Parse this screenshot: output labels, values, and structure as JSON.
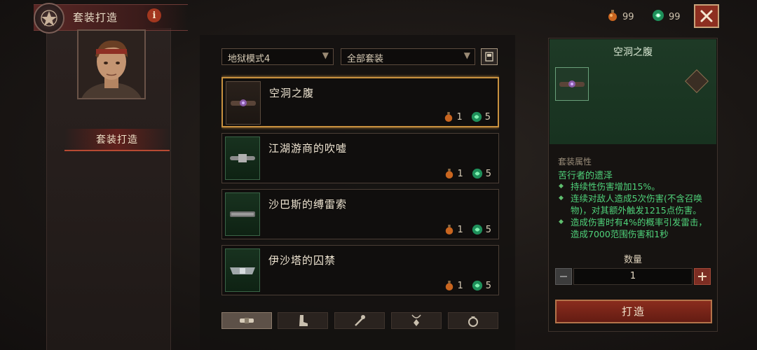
{
  "header": {
    "title": "套装打造",
    "info_icon": "info-icon",
    "emblem_icon": "pentagram-icon"
  },
  "sidebar": {
    "tab_label": "套装打造"
  },
  "currency": [
    {
      "icon": "potion-icon",
      "amount": "99"
    },
    {
      "icon": "green-gem-icon",
      "amount": "99"
    }
  ],
  "close_icon": "close-icon",
  "filters": {
    "difficulty": "地狱模式4",
    "set": "全部套装",
    "codex_icon": "book-icon"
  },
  "items": [
    {
      "name": "空洞之腹",
      "potion": "1",
      "gem": "5",
      "selected": true,
      "icon": "belt-icon"
    },
    {
      "name": "江湖游商的吹嘘",
      "potion": "1",
      "gem": "5",
      "selected": false,
      "icon": "belt-icon"
    },
    {
      "name": "沙巴斯的缚雷索",
      "potion": "1",
      "gem": "5",
      "selected": false,
      "icon": "belt-icon"
    },
    {
      "name": "伊沙塔的囚禁",
      "potion": "1",
      "gem": "5",
      "selected": false,
      "icon": "belt-icon"
    }
  ],
  "bottom_tabs": [
    {
      "icon": "belt-icon",
      "active": true
    },
    {
      "icon": "boots-icon",
      "active": false
    },
    {
      "icon": "wand-icon",
      "active": false
    },
    {
      "icon": "amulet-icon",
      "active": false
    },
    {
      "icon": "ring-icon",
      "active": false
    }
  ],
  "detail": {
    "title": "空洞之腹",
    "props_label": "套装属性",
    "bonus_title": "苦行者的遗泽",
    "bonuses": [
      "持续性伤害增加15%。",
      "连续对敌人造成5次伤害(不含召唤物)，对其额外触发1215点伤害。",
      "造成伤害时有4%的概率引发雷击，造成7000范围伤害和1秒"
    ],
    "quantity_label": "数量",
    "quantity": "1",
    "forge_label": "打造"
  },
  "colors": {
    "accent_red": "#8a2c1d",
    "set_green": "#4fd27a",
    "selected_border": "#c8913f"
  }
}
